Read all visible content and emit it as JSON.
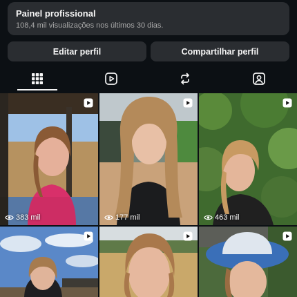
{
  "dashboard": {
    "title": "Painel profissional",
    "subtitle": "108,4 mil visualizações nos últimos 30 dias."
  },
  "actions": {
    "edit_label": "Editar perfil",
    "share_label": "Compartilhar perfil"
  },
  "tabs": [
    {
      "icon": "grid-icon",
      "active": true
    },
    {
      "icon": "reels-icon",
      "active": false
    },
    {
      "icon": "repost-icon",
      "active": false
    },
    {
      "icon": "tagged-icon",
      "active": false
    }
  ],
  "grid": [
    {
      "type": "reel",
      "views": "383 mil"
    },
    {
      "type": "reel",
      "views": "177 mil"
    },
    {
      "type": "reel",
      "views": "463 mil"
    },
    {
      "type": "reel",
      "views": ""
    },
    {
      "type": "reel",
      "views": ""
    },
    {
      "type": "reel",
      "views": ""
    }
  ],
  "colors": {
    "background": "#0c1014",
    "button": "#2a2d31",
    "text": "#f5f5f5",
    "muted": "#a8a8a8"
  }
}
